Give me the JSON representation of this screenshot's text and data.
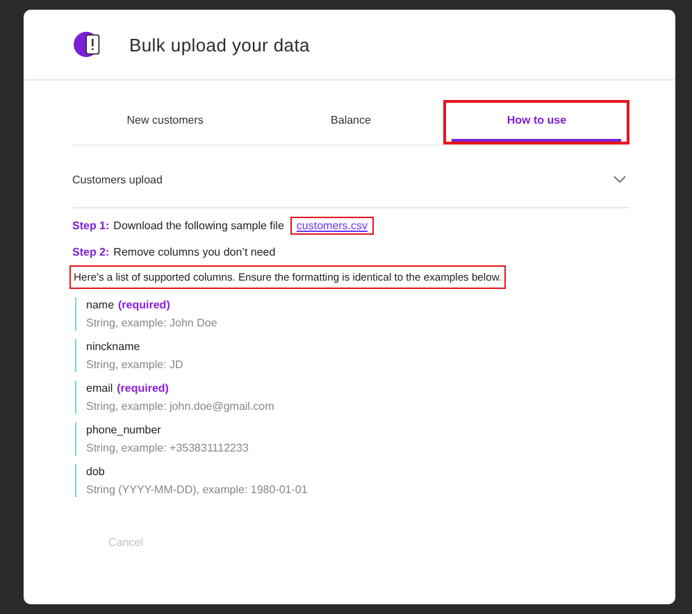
{
  "dialog": {
    "title": "Bulk upload your data"
  },
  "tabs": [
    {
      "label": "New customers",
      "selected": false,
      "highlighted": false
    },
    {
      "label": "Balance",
      "selected": false,
      "highlighted": false
    },
    {
      "label": "How to use",
      "selected": true,
      "highlighted": true
    }
  ],
  "section": {
    "title": "Customers upload",
    "expanded": true
  },
  "steps": [
    {
      "label": "Step 1:",
      "text": "Download the following sample file",
      "link": "customers.csv",
      "link_highlighted": true
    },
    {
      "label": "Step 2:",
      "text": "Remove columns you don’t need"
    }
  ],
  "note": {
    "text": "Here’s a list of supported columns. Ensure the formatting is identical to the examples below.",
    "highlighted": true
  },
  "columns": [
    {
      "name": "name",
      "tag": "(required)",
      "description": "String, example: John Doe"
    },
    {
      "name": "ninckname",
      "description": "String, example: JD"
    },
    {
      "name": "email",
      "tag": "(required)",
      "description": "String, example: john.doe@gmail.com"
    },
    {
      "name": "phone_number",
      "description": "String, example: +353831112233"
    },
    {
      "name": "dob",
      "description": "String (YYYY-MM-DD), example: 1980-01-01"
    }
  ],
  "buttons": [
    {
      "label": "Cancel",
      "disabled": true
    }
  ]
}
